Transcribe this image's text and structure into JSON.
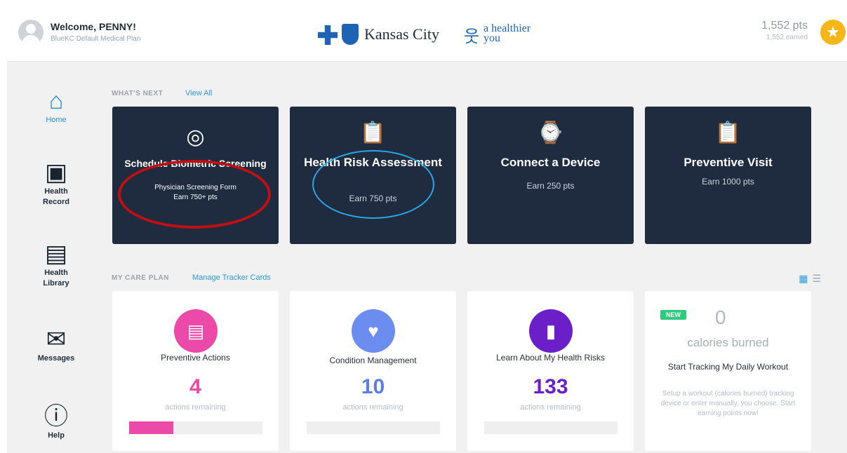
{
  "header": {
    "welcome": "Welcome, PENNY!",
    "plan": "BlueKC Default Medical Plan",
    "logo_city": "Kansas City",
    "logo_tagline": "a healthier you",
    "points": "1,552 pts",
    "points_earned": "1,552 earned"
  },
  "sidebar": {
    "items": [
      {
        "label": "Home",
        "icon": "home-icon"
      },
      {
        "label": "Health Record",
        "icon": "clipboard-plus-icon"
      },
      {
        "label": "Health Library",
        "icon": "book-icon"
      },
      {
        "label": "Messages",
        "icon": "inbox-icon"
      },
      {
        "label": "Help",
        "icon": "info-icon"
      }
    ]
  },
  "whats_next": {
    "title": "WHAT'S NEXT",
    "link": "View All",
    "cards": [
      {
        "title": "Schedule Biometric Screening",
        "sub1": "Physician Screening Form",
        "sub2": "Earn 750+ pts",
        "icon": "fingerprint-icon"
      },
      {
        "title": "Health Risk Assessment",
        "sub": "Earn 750 pts",
        "icon": "clipboard-icon"
      },
      {
        "title": "Connect a Device",
        "sub": "Earn 250 pts",
        "icon": "watch-icon"
      },
      {
        "title": "Preventive Visit",
        "sub": "Earn 1000 pts",
        "icon": "clipboard-icon"
      }
    ]
  },
  "care_plan": {
    "title": "MY CARE PLAN",
    "link": "Manage Tracker Cards",
    "cards": [
      {
        "name": "Preventive Actions",
        "count": "4",
        "remaining": "actions remaining",
        "color": "#ec4aa8",
        "progress": 0.33
      },
      {
        "name": "Condition Management",
        "count": "10",
        "remaining": "actions remaining",
        "color": "#6b8df0",
        "progress": 0
      },
      {
        "name": "Learn About My Health Risks",
        "count": "133",
        "remaining": "actions remaining",
        "color": "#6a1fc9",
        "progress": 0
      }
    ],
    "workout": {
      "badge": "NEW",
      "value": "0",
      "unit": "calories burned",
      "title": "Start Tracking My Daily Workout",
      "description": "Setup a workout (calories burned) tracking device or enter manually, you choose. Start earning points now!"
    }
  },
  "colors": {
    "accent": "#2a9ad8",
    "navy": "#1f2b3f",
    "star": "#f6b618",
    "highlight_red": "#c10f13",
    "highlight_blue": "#2aa8e6"
  }
}
